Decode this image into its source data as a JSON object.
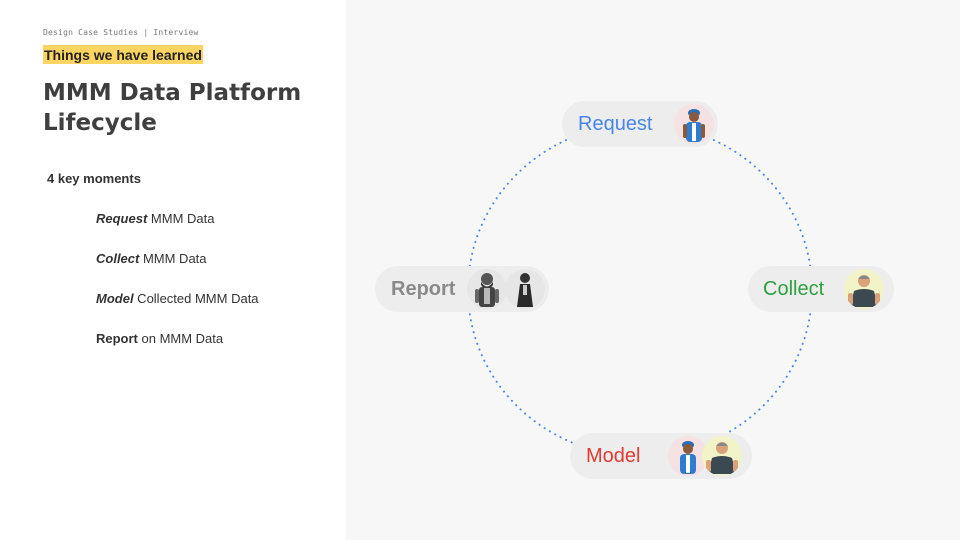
{
  "header": {
    "breadcrumb": "Design Case Studies | Interview",
    "highlight": "Things we have learned",
    "title": "MMM Data Platform Lifecycle"
  },
  "moments": {
    "heading": "4 key moments",
    "items": [
      {
        "key": "Request",
        "rest": " MMM Data"
      },
      {
        "key": "Collect",
        "rest": " MMM Data"
      },
      {
        "key": "Model",
        "rest": " Collected MMM Data"
      },
      {
        "key": "Report",
        "rest": " on MMM Data"
      }
    ]
  },
  "cycle": {
    "request": {
      "label": "Request",
      "color": "#4a86e8"
    },
    "collect": {
      "label": "Collect",
      "color": "#2ea043"
    },
    "model": {
      "label": "Model",
      "color": "#e03c31"
    },
    "report": {
      "label": "Report",
      "color": "#8a8a8a"
    },
    "ring_color": "#4a86e8"
  }
}
